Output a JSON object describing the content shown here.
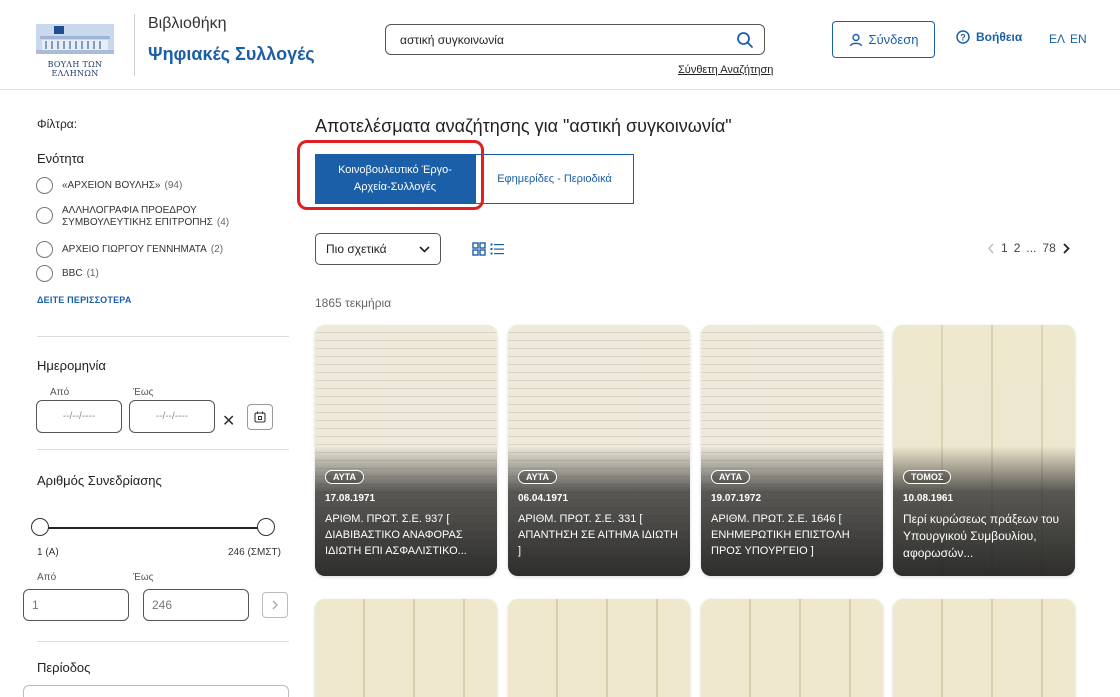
{
  "header": {
    "logo_text": "ΒΟΥΛΗ ΤΩΝ ΕΛΛΗΝΩΝ",
    "brand_line1": "Βιβλιοθήκη",
    "brand_line2": "Ψηφιακές Συλλογές",
    "search_value": "αστική συγκοινωνία",
    "advanced_search": "Σύνθετη Αναζήτηση",
    "login_label": "Σύνδεση",
    "help_label": "Βοήθεια",
    "lang_el": "ΕΛ",
    "lang_en": "EN",
    "accent": "#1b5fa8"
  },
  "sidebar": {
    "filters_label": "Φίλτρα:",
    "section_label": "Ενότητα",
    "items": [
      {
        "label": "«ΑΡΧΕΙΟΝ ΒΟΥΛΗΣ»",
        "count": "(94)"
      },
      {
        "label": "ΑΛΛΗΛΟΓΡΑΦΙΑ ΠΡΟΕΔΡΟΥ ΣΥΜΒΟΥΛΕΥΤΙΚΗΣ ΕΠΙΤΡΟΠΗΣ",
        "count": "(4)"
      },
      {
        "label": "ΑΡΧΕΙΟ ΓΙΩΡΓΟΥ ΓΕΝΝΗΜΑΤΑ",
        "count": "(2)"
      },
      {
        "label": "BBC",
        "count": "(1)"
      }
    ],
    "see_more": "ΔΕΙΤΕ ΠΕΡΙΣΣΟΤΕΡΑ",
    "date_label": "Ημερομηνία",
    "date_from_label": "Από",
    "date_to_label": "Έως",
    "date_placeholder": "--/--/----",
    "session_label": "Αριθμός Συνεδρίασης",
    "slider_min_label": "1 (Α)",
    "slider_max_label": "246 (ΣΜΣΤ)",
    "num_from_label": "Από",
    "num_to_label": "Έως",
    "num_from_value": "1",
    "num_to_value": "246",
    "period_label": "Περίοδος"
  },
  "main": {
    "results_title": "Αποτελέσματα αναζήτησης για \"αστική συγκοινωνία\"",
    "tabs": [
      {
        "label": "Κοινοβουλευτικό Έργο-Αρχεία-Συλλογές",
        "active": true
      },
      {
        "label": "Εφημερίδες - Περιοδικά",
        "active": false
      }
    ],
    "sort_label": "Πιο σχετικά",
    "pagination": {
      "page1": "1",
      "page2": "2",
      "ellipsis": "...",
      "last": "78"
    },
    "items_count": "1865 τεκμήρια",
    "cards": [
      {
        "badge": "ΑΥΤΑ",
        "date": "17.08.1971",
        "title": "ΑΡΙΘΜ. ΠΡΩΤ. Σ.Ε. 937 [ ΔΙΑΒΙΒΑΣΤΙΚΟ ΑΝΑΦΟΡΑΣ ΙΔΙΩΤΗ ΕΠΙ ΑΣΦΑΛΙΣΤΙΚΟ..."
      },
      {
        "badge": "ΑΥΤΑ",
        "date": "06.04.1971",
        "title": "ΑΡΙΘΜ. ΠΡΩΤ. Σ.Ε. 331 [ ΑΠΑΝΤΗΣΗ ΣΕ ΑΙΤΗΜΑ ΙΔΙΩΤΗ ]"
      },
      {
        "badge": "ΑΥΤΑ",
        "date": "19.07.1972",
        "title": "ΑΡΙΘΜ. ΠΡΩΤ. Σ.Ε. 1646 [ ΕΝΗΜΕΡΩΤΙΚΗ ΕΠΙΣΤΟΛΗ ΠΡΟΣ ΥΠΟΥΡΓΕΙΟ ]"
      },
      {
        "badge": "ΤΟΜΟΣ",
        "date": "10.08.1961",
        "title": "Περί κυρώσεως πράξεων του Υπουργικού Συμβουλίου, αφορωσών..."
      }
    ]
  }
}
